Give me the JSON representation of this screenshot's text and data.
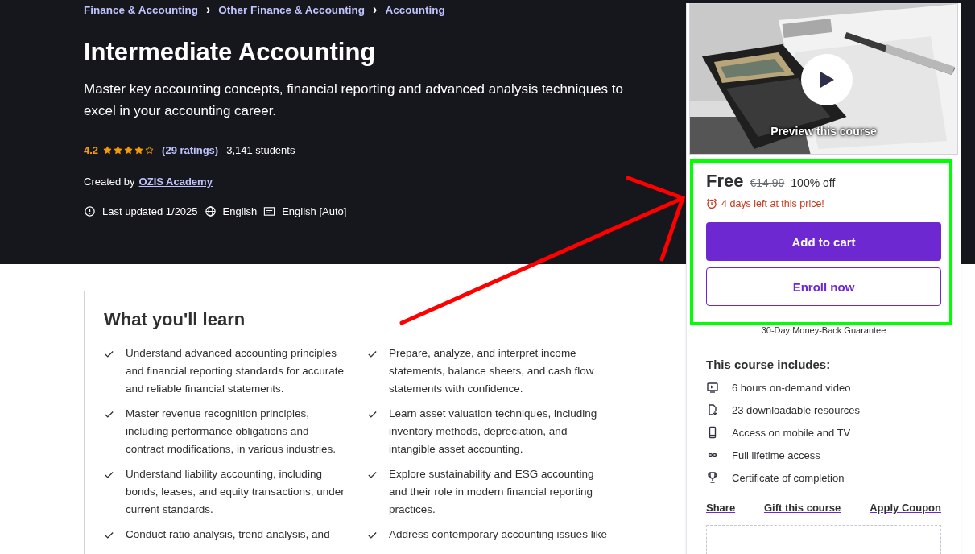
{
  "breadcrumbs": [
    {
      "label": "Finance & Accounting"
    },
    {
      "label": "Other Finance & Accounting"
    },
    {
      "label": "Accounting"
    }
  ],
  "breadcrumb_separator": "›",
  "course": {
    "title": "Intermediate Accounting",
    "subtitle": "Master key accounting concepts, financial reporting and advanced analysis techniques to excel in your accounting career.",
    "rating": "4.2",
    "stars": 4,
    "ratings_link": "(29 ratings)",
    "students": "3,141 students",
    "created_by_label": "Created by",
    "author": "OZIS Academy",
    "last_updated": "Last updated 1/2025",
    "language": "English",
    "captions": "English [Auto]"
  },
  "learn": {
    "title": "What you'll learn",
    "items": [
      {
        "text": "Understand advanced accounting principles and financial reporting standards for accurate and reliable financial statements."
      },
      {
        "text": "Prepare, analyze, and interpret income statements, balance sheets, and cash flow statements with confidence."
      },
      {
        "text": "Master revenue recognition principles, including performance obligations and contract modifications, in various industries."
      },
      {
        "text": "Learn asset valuation techniques, including inventory methods, depreciation, and intangible asset accounting."
      },
      {
        "text": "Understand liability accounting, including bonds, leases, and equity transactions, under current standards."
      },
      {
        "text": "Explore sustainability and ESG accounting and their role in modern financial reporting practices."
      },
      {
        "text": "Conduct ratio analysis, trend analysis, and"
      },
      {
        "text": "Address contemporary accounting issues like"
      }
    ]
  },
  "sidebar": {
    "preview": {
      "kind": "picture",
      "label": "Preview this course"
    },
    "price": "Free",
    "original_price": "€14.99",
    "discount": "100% off",
    "deadline": "4 days left at this price!",
    "buttons": [
      {
        "label": "Add to cart",
        "kind": "primary"
      },
      {
        "label": "Enroll now",
        "kind": "outline"
      }
    ],
    "guarantee": "30-Day Money-Back Guarantee",
    "includes_title": "This course includes:",
    "includes": [
      {
        "kind": "video",
        "text": "6 hours on-demand video"
      },
      {
        "kind": "file",
        "text": "23 downloadable resources"
      },
      {
        "kind": "mobile",
        "text": "Access on mobile and TV"
      },
      {
        "kind": "infinity",
        "text": "Full lifetime access"
      },
      {
        "kind": "trophy",
        "text": "Certificate of completion"
      }
    ],
    "links": [
      {
        "label": "Share"
      },
      {
        "label": "Gift this course"
      },
      {
        "label": "Apply Coupon"
      }
    ]
  },
  "annotations": {
    "arrow": true,
    "highlight": true
  }
}
